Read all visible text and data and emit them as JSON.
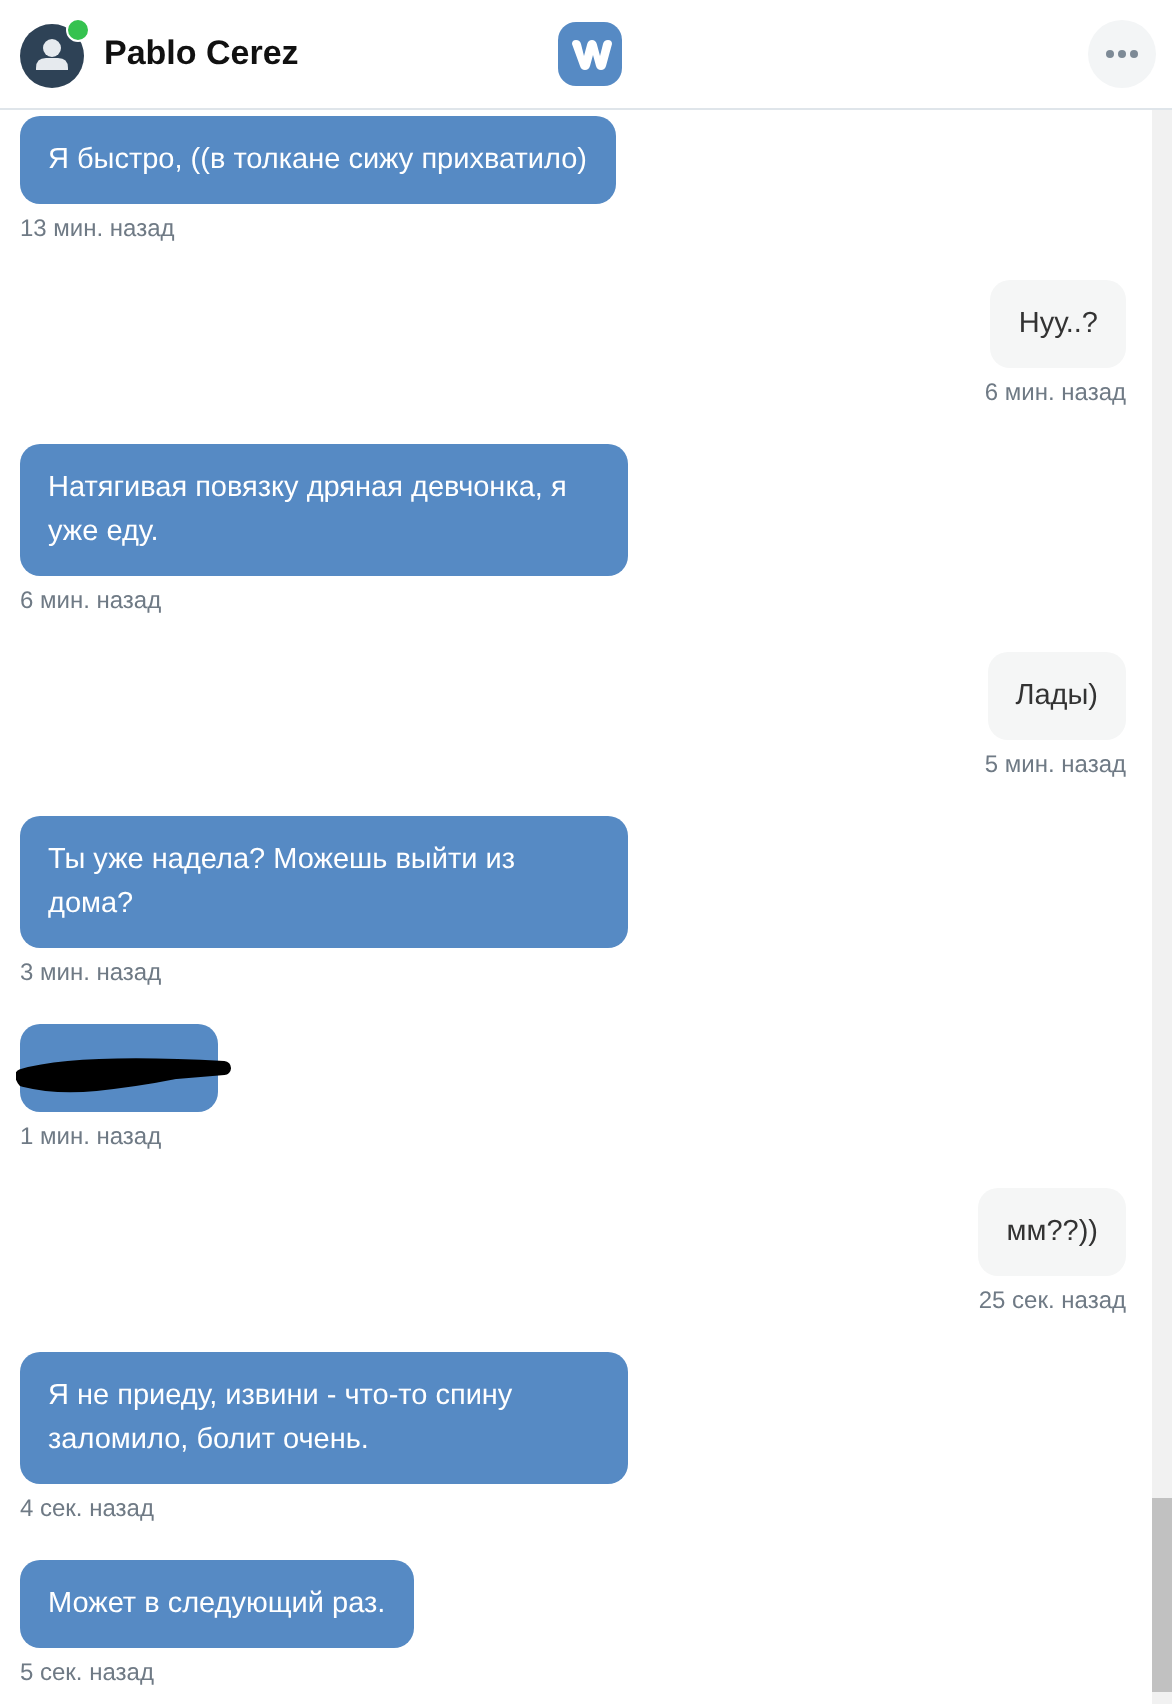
{
  "header": {
    "contact_name": "Pablo Cerez",
    "online": true
  },
  "messages": [
    {
      "kind": "incoming",
      "text": "Я быстро, ((в толкане сижу прихватило)",
      "time": "13 мин. назад"
    },
    {
      "kind": "outgoing",
      "text": "Нуу..?",
      "time": "6 мин. назад"
    },
    {
      "kind": "incoming",
      "text": "Натягивая повязку дряная девчонка, я уже еду.",
      "time": "6 мин. назад"
    },
    {
      "kind": "outgoing",
      "text": "Лады)",
      "time": "5 мин. назад"
    },
    {
      "kind": "incoming",
      "text": "Ты уже надела? Можешь выйти из дома?",
      "time": "3 мин. назад"
    },
    {
      "kind": "redacted",
      "time": "1 мин. назад"
    },
    {
      "kind": "outgoing",
      "text": "мм??))",
      "time": "25 сек. назад"
    },
    {
      "kind": "incoming",
      "text": "Я не приеду, извини - что-то спину заломило, болит очень.",
      "time": "4 сек. назад"
    },
    {
      "kind": "incoming",
      "text": "Может в следующий раз.",
      "time": "5 сек. назад"
    }
  ]
}
